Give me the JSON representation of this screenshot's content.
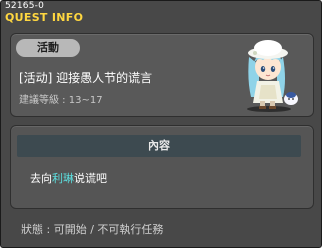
{
  "window": {
    "quest_id": "52165-0",
    "title": "QUEST INFO"
  },
  "header": {
    "tag": "活動",
    "quest_name": "[活动] 迎接愚人节的谎言",
    "level_label": "建議等級 : 13~17",
    "npc_portrait": "npc-girl-white-hat"
  },
  "content": {
    "heading": "內容",
    "desc_prefix": "去向",
    "npc_name": "利琳",
    "desc_suffix": "说谎吧"
  },
  "status": {
    "text": "狀態 : 可開始 / 不可執行任務"
  },
  "colors": {
    "title": "#ffd740",
    "npc_name": "#5ce0e0",
    "window_bg": "#484848",
    "content_bar": "#3d4a50"
  }
}
